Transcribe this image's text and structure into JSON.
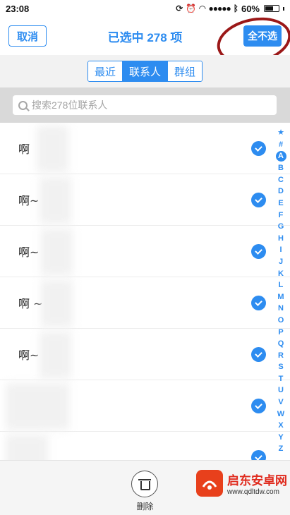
{
  "status_bar": {
    "time": "23:08",
    "battery": "60%",
    "battery_level": 0.6
  },
  "nav": {
    "cancel_label": "取消",
    "title": "已选中 278 项",
    "deselect_all_label": "全不选"
  },
  "segments": [
    {
      "label": "最近",
      "active": false
    },
    {
      "label": "联系人",
      "active": true
    },
    {
      "label": "群组",
      "active": false
    }
  ],
  "search": {
    "placeholder": "搜索278位联系人"
  },
  "contacts": [
    {
      "name": "啊",
      "checked": true
    },
    {
      "name": "啊~",
      "checked": true
    },
    {
      "name": "啊~",
      "checked": true
    },
    {
      "name": "啊 ~",
      "checked": true
    },
    {
      "name": "啊~",
      "checked": true
    },
    {
      "name": "",
      "checked": true
    },
    {
      "name": "",
      "checked": true
    }
  ],
  "alpha_index": [
    "★",
    "#",
    "A",
    "B",
    "C",
    "D",
    "E",
    "F",
    "G",
    "H",
    "I",
    "J",
    "K",
    "L",
    "M",
    "N",
    "O",
    "P",
    "Q",
    "R",
    "S",
    "T",
    "U",
    "V",
    "W",
    "X",
    "Y",
    "Z"
  ],
  "alpha_active": "A",
  "bottom": {
    "delete_label": "删除"
  },
  "watermark": {
    "title": "启东安卓网",
    "url": "www.qdltdw.com"
  },
  "colors": {
    "accent": "#2d8cf0",
    "annotation": "#9b1818",
    "watermark": "#e8401c"
  }
}
